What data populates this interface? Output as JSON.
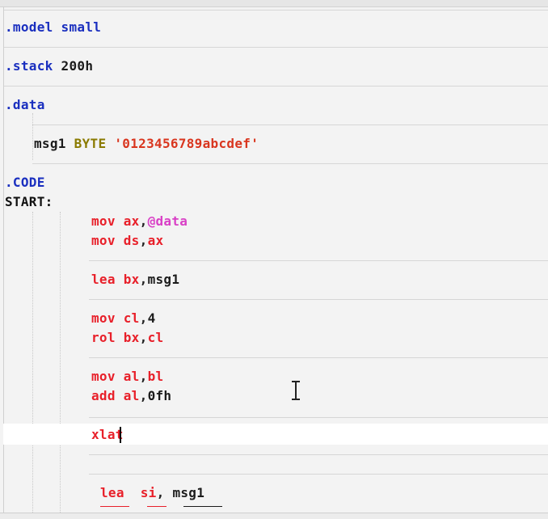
{
  "editor": {
    "lines": {
      "model": {
        "directive": ".model",
        "arg": "small"
      },
      "stack": {
        "directive": ".stack",
        "arg": "200h"
      },
      "data": {
        "directive": ".data"
      },
      "msg1": {
        "name": "msg1",
        "type": "BYTE",
        "value": "'0123456789abcdef'"
      },
      "code": {
        "directive": ".CODE"
      },
      "start": {
        "label": "START:"
      },
      "mov_ax": {
        "mnemonic": "mov",
        "reg": "ax",
        "comma": ",",
        "operand": "@data"
      },
      "mov_ds": {
        "mnemonic": "mov",
        "reg1": "ds",
        "comma": ",",
        "reg2": "ax"
      },
      "lea_bx": {
        "mnemonic": "lea",
        "reg": "bx",
        "comma": ",",
        "operand": "msg1"
      },
      "mov_cl": {
        "mnemonic": "mov",
        "reg": "cl",
        "comma": ",",
        "operand": "4"
      },
      "rol_bx": {
        "mnemonic": "rol",
        "reg1": "bx",
        "comma": ",",
        "reg2": "cl"
      },
      "mov_al": {
        "mnemonic": "mov",
        "reg1": "al",
        "comma": ",",
        "reg2": "bl"
      },
      "add_al": {
        "mnemonic": "add",
        "reg": "al",
        "comma": ",",
        "operand": "0fh"
      },
      "xlat": {
        "mnemonic": "xlat"
      },
      "lea_si": {
        "mnemonic": "lea",
        "reg": "si",
        "comma": ",",
        "operand": "msg1"
      }
    },
    "colors": {
      "background": "#f3f3f3",
      "current_line": "#ffffff",
      "directive": "#1a2fbf",
      "keyword": "#8a7a00",
      "string": "#d9361f",
      "instruction": "#e8202a",
      "directive_ref": "#d940c6"
    }
  }
}
